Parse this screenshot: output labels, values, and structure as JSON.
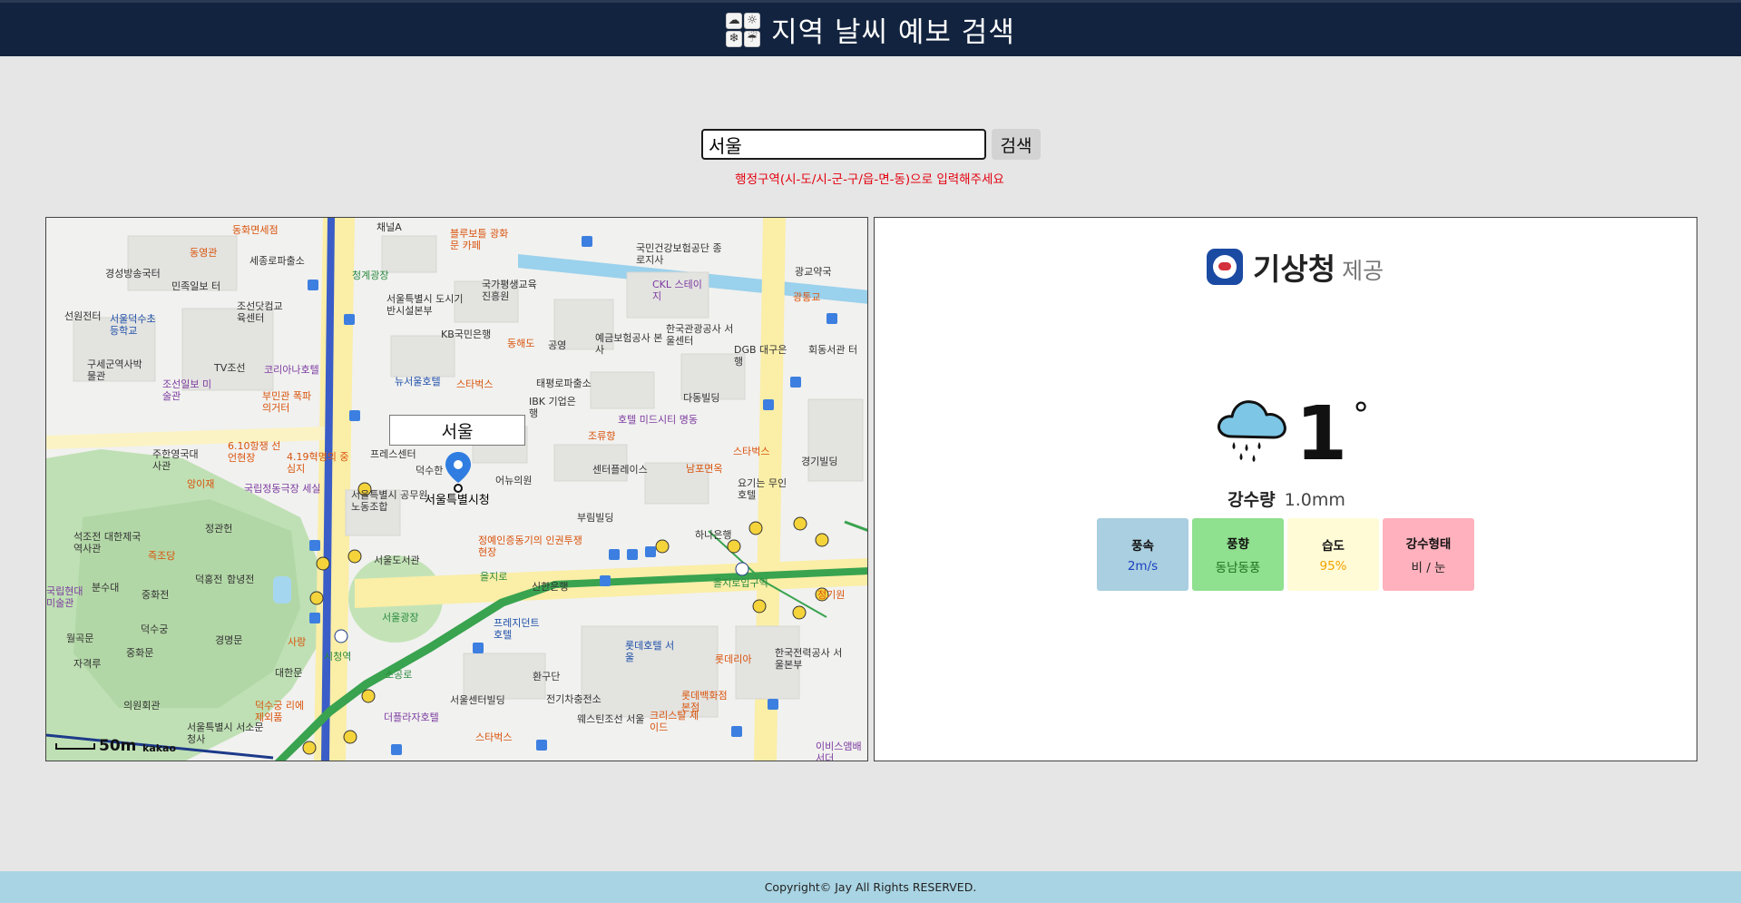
{
  "header": {
    "title": "지역 날씨 예보 검색",
    "logo_glyphs": [
      "☁",
      "☼",
      "❄",
      "☔"
    ]
  },
  "search": {
    "value": "서울",
    "button_label": "검색",
    "hint": "행정구역(시-도/시-군-구/읍-면-동)으로 입력해주세요"
  },
  "map": {
    "search_label": "서울",
    "city_hall_label": "서울특별시청",
    "scale_label": "50m",
    "provider": "kakao",
    "labels": [
      "동화면세점",
      "세종로파출소",
      "채널A",
      "블루보틀 광화문 카페",
      "국민건강보험공단 종로지사",
      "광교약국",
      "동영관",
      "경성방송국터",
      "민족일보 터",
      "청계광장",
      "국가평생교육진흥원",
      "CKL 스테이지",
      "광통교",
      "선원전터",
      "서울덕수초등학교",
      "조선닷컴교육센터",
      "서울특별시 도시기반시설본부",
      "KB국민은행",
      "예금보험공사 본사",
      "한국관광공사 서울센터",
      "동해도",
      "공영",
      "DGB 대구은행",
      "회동서관 터",
      "구세군역사박물관",
      "TV조선",
      "코리아나호텔",
      "조선일보 미술관",
      "뉴서울호텔",
      "스타벅스",
      "태평로파출소",
      "다동빌딩",
      "부민관 폭파의거터",
      "IBK 기업은행",
      "호텔 미드시티 명동",
      "6.10항쟁 선언현장",
      "4.19혁명의 중심지",
      "프레스센터",
      "조류향",
      "스타벅스",
      "경기빌딩",
      "주한영국대사관",
      "앙이재",
      "국립정동극장 세실",
      "덕수한",
      "어뉴의원",
      "센터플레이스",
      "남포면옥",
      "요기는 무인호텔",
      "서울특별시 공무원노동조합",
      "부림빌딩",
      "정관헌",
      "정예인증동기의 인권투쟁 현장",
      "하나은행",
      "석조전 대한제국역사관",
      "즉조당",
      "서울도서관",
      "덕홍전",
      "함녕전",
      "신한은행",
      "중화전",
      "서울광장",
      "국립현대 미술관",
      "분수대",
      "덕수궁",
      "프레지던트 호텔",
      "롯데호텔 서울",
      "월곡문",
      "경명문",
      "중화문",
      "사랑",
      "롯데리아",
      "한국전력공사 서울본부",
      "자격루",
      "시청역",
      "소공로",
      "환구단",
      "대한문",
      "의원회관",
      "덕수궁 리에제외품",
      "서울센터빌딩",
      "전기차충전소",
      "롯데백화점 본점",
      "서울특별시 서소문청사",
      "더플라자호텔",
      "웨스틴조선 서울",
      "크리스탈 제이드",
      "스타벅스",
      "이비스앰배서더",
      "을지로입구역",
      "을지로",
      "정기원"
    ]
  },
  "weather": {
    "provider_name": "기상청",
    "provider_suffix": "제공",
    "temperature": "1",
    "degree_symbol": "°",
    "precip_label": "강수량",
    "precip_value": "1.0mm",
    "cards": [
      {
        "label": "풍속",
        "value": "2m/s"
      },
      {
        "label": "풍향",
        "value": "동남동풍"
      },
      {
        "label": "습도",
        "value": "95%"
      },
      {
        "label": "강수형태",
        "value": "비 / 눈"
      }
    ],
    "colors": {
      "wind_speed": "#a9cfe0",
      "wind_dir": "#8fe08f",
      "humidity": "#fffbd6",
      "precip_type": "#ffb1bd"
    }
  },
  "footer": {
    "copyright": "Copyright© Jay All Rights RESERVED."
  }
}
